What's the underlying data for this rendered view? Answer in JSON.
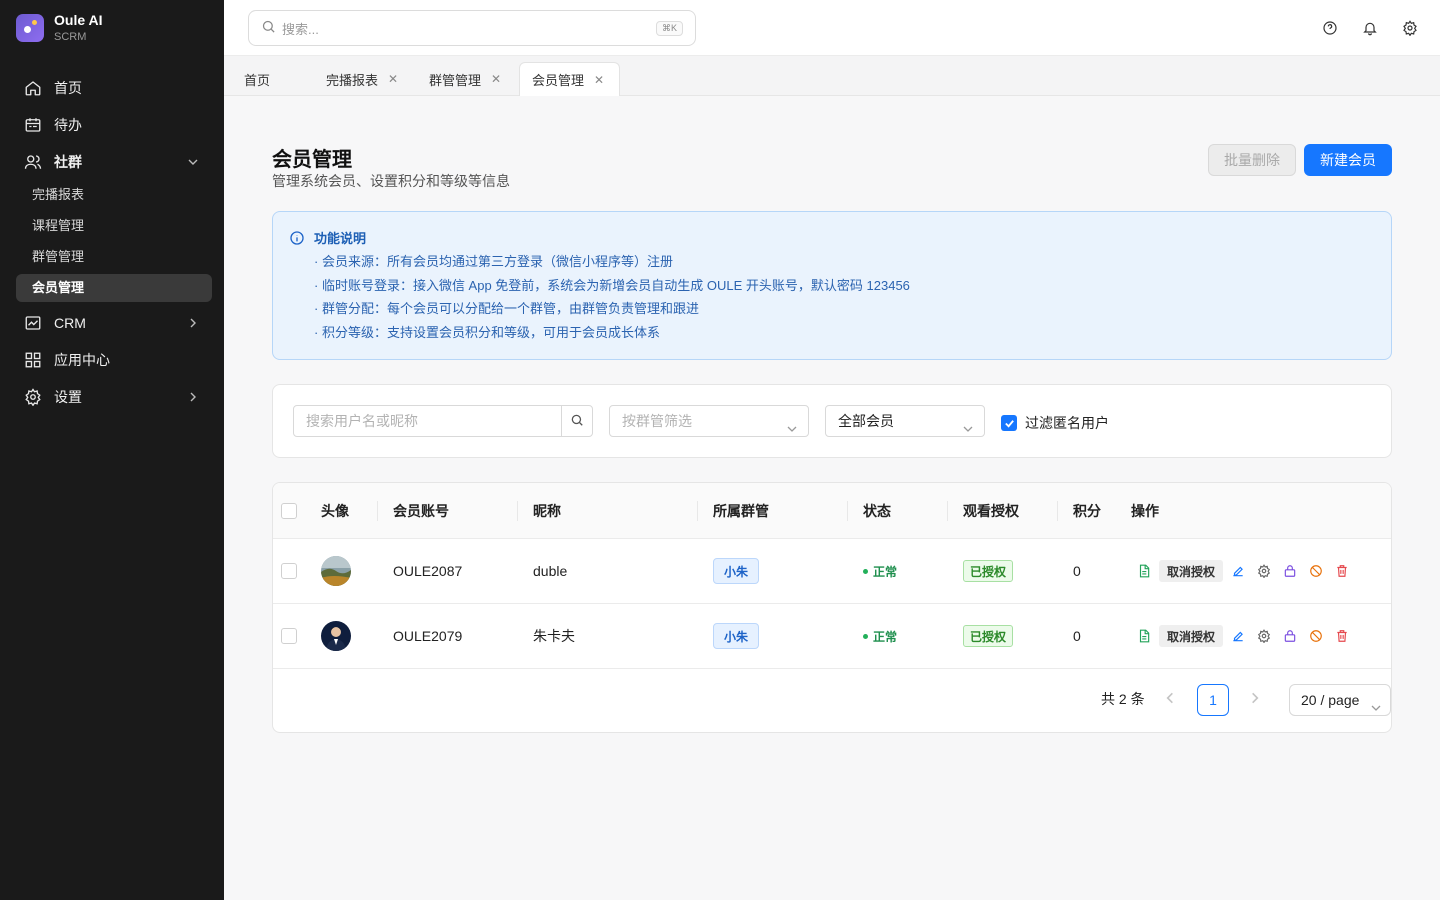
{
  "brand": {
    "name": "Oule AI",
    "sub": "SCRM"
  },
  "sidebar": {
    "items": [
      {
        "label": "首页",
        "icon": "home-icon"
      },
      {
        "label": "待办",
        "icon": "calendar-icon"
      },
      {
        "label": "社群",
        "icon": "users-icon",
        "expanded": true,
        "children": [
          "完播报表",
          "课程管理",
          "群管管理",
          "会员管理"
        ],
        "active_child": "会员管理"
      },
      {
        "label": "CRM",
        "icon": "chart-icon"
      },
      {
        "label": "应用中心",
        "icon": "grid-icon"
      },
      {
        "label": "设置",
        "icon": "gear-icon"
      }
    ]
  },
  "header": {
    "search_placeholder": "搜索...",
    "shortcut": "⌘K"
  },
  "tabs": [
    {
      "label": "首页",
      "closable": false
    },
    {
      "label": "完播报表",
      "closable": true
    },
    {
      "label": "群管管理",
      "closable": true
    },
    {
      "label": "会员管理",
      "closable": true,
      "active": true
    }
  ],
  "page": {
    "title": "会员管理",
    "description": "管理系统会员、设置积分和等级等信息",
    "batch_delete": "批量删除",
    "new_member": "新建会员"
  },
  "info": {
    "title": "功能说明",
    "lines": [
      "· 会员来源：所有会员均通过第三方登录（微信小程序等）注册",
      "· 临时账号登录：接入微信 App 免登前，系统会为新增会员自动生成 OULE 开头账号，默认密码 123456",
      "· 群管分配：每个会员可以分配给一个群管，由群管负责管理和跟进",
      "· 积分等级：支持设置会员积分和等级，可用于会员成长体系"
    ]
  },
  "filters": {
    "search_placeholder": "搜索用户名或昵称",
    "group_placeholder": "按群管筛选",
    "member_type": "全部会员",
    "filter_anonymous": "过滤匿名用户",
    "filter_anonymous_checked": true
  },
  "table": {
    "columns": [
      "头像",
      "会员账号",
      "昵称",
      "所属群管",
      "状态",
      "观看授权",
      "积分",
      "操作"
    ],
    "rows": [
      {
        "account": "OULE2087",
        "nickname": "duble",
        "group": "小朱",
        "status": "正常",
        "auth": "已授权",
        "points": "0",
        "action": "取消授权"
      },
      {
        "account": "OULE2079",
        "nickname": "朱卡夫",
        "group": "小朱",
        "status": "正常",
        "auth": "已授权",
        "points": "0",
        "action": "取消授权"
      }
    ]
  },
  "pagination": {
    "total": "共 2 条",
    "current": "1",
    "page_size": "20 / page"
  },
  "colors": {
    "primary": "#1677ff",
    "sidebar_bg": "#1a1a1a",
    "info_bg": "#eaf3fd",
    "success": "#23b05a",
    "danger": "#e5484d",
    "purple": "#7b4fe0",
    "warning": "#e8710a"
  }
}
